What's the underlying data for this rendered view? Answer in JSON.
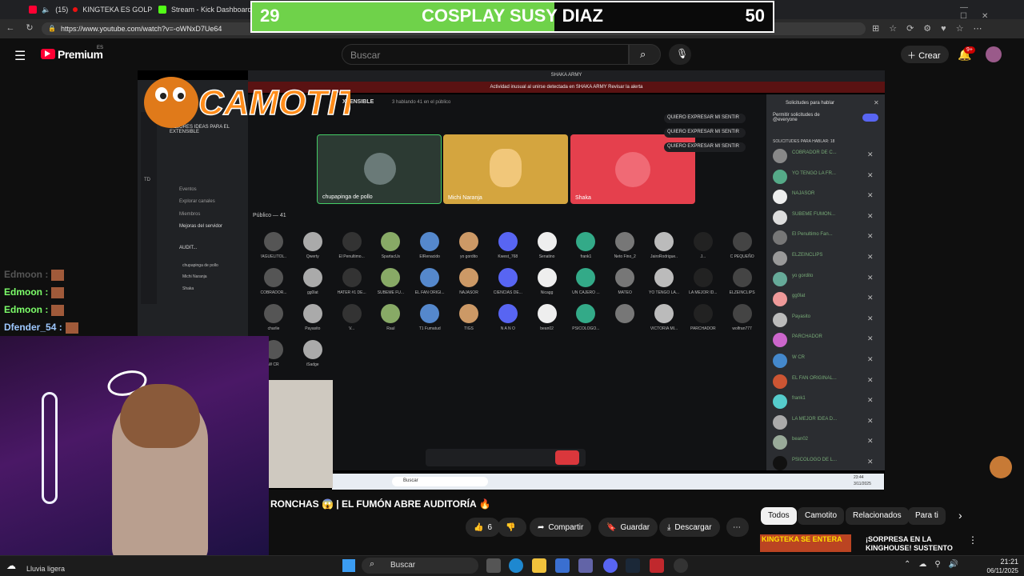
{
  "browser": {
    "tabs": [
      {
        "label": "(15)"
      },
      {
        "label": "KINGTEKA ES GOLP"
      },
      {
        "label": "Stream - Kick Dashboard"
      }
    ],
    "url": "https://www.youtube.com/watch?v=-oWNxD7Ue64"
  },
  "vote_overlay": {
    "left_count": "29",
    "title": "COSPLAY SUSY DIAZ",
    "right_count": "50",
    "left_fraction": 0.58
  },
  "youtube": {
    "logo_text": "Premium",
    "region": "ES",
    "search_placeholder": "Buscar",
    "create_label": "Crear",
    "notif_badge": "9+"
  },
  "video": {
    "logo_text": "CAMOTITO",
    "server_header": "SHAKA ARMY",
    "alert_text": "Actividad inusual al unirse detectada en SHAKA ARMY   Revisar la alerta",
    "channel_name": "XTENSIBLE",
    "channel_meta": "3 hablando   41 en el público",
    "sidebar": {
      "title": "MEJORES IDEAS PARA EL EXTENSIBLE",
      "items": [
        "Eventos",
        "Explorar canales",
        "Miembros",
        "Mejoras del servidor",
        "AUDIT...",
        "chupapinga de pollo",
        "Michi Naranja",
        "Shaka"
      ],
      "badge": "TD"
    },
    "speakers": [
      {
        "name": "chupapinga de pollo",
        "color": "#2c3a33"
      },
      {
        "name": "Michi Naranja",
        "color": "#d4a53f"
      },
      {
        "name": "Shaka",
        "color": "#e5404d"
      }
    ],
    "speaker_pill": "QUIERO EXPRESAR MI SENTIR",
    "public_label": "Público — 41",
    "audience": [
      "!AGUELITOL..",
      "Qwerty",
      "El Penultimo...",
      "SpartacUs",
      "ElRenacido",
      "yo gordito",
      "Kwest_768",
      "Senatino",
      "frank1",
      "Neto Fino_2",
      "JairoRodrigue..",
      "J...",
      "C PEQUEÑO",
      "COBRADOR...",
      "gg0lat",
      "HATER #1 DE...",
      "SUBEME FU...",
      "EL FAN ORIGI...",
      "NAJASOR",
      "CIENCIAS DE...",
      "Nicagg",
      "UN CAJERO ...",
      "MATEO",
      "YO TENGO LA...",
      "LA MEJOR ID...",
      "ELZEINCLIPS",
      "charlie",
      "Payasito",
      "V...",
      "Raul",
      "T1 Fumatud",
      "TIGS",
      "N A N O",
      "bean02",
      "PSICOLOGO...",
      "",
      "VICTORIA MI...",
      "PARCHADOR",
      "wolfran777",
      "W CR",
      "iSadge"
    ],
    "right_panel": {
      "title": "Solicitudes para hablar",
      "permit_label": "Permitir solicitudes de @everyone",
      "requests_label": "SOLICITUDES PARA HABLAR: 18",
      "requests": [
        "COBRADOR DE C...",
        "YO TENGO LA FR...",
        "NAJASOR",
        "SUBEME FUMON...",
        "El Penultimo Fan...",
        "ELZEINCLIPS",
        "yo gordito",
        "gg0lat",
        "Payasito",
        "PARCHADOR",
        "W CR",
        "EL FAN ORIGINAL...",
        "frank1",
        "LA MEJOR IDEA D...",
        "bean02",
        "PSICOLOGO DE L..."
      ]
    },
    "win_search": "Buscar",
    "win_time": "23:44",
    "win_date": "3/11/2025"
  },
  "chat": [
    {
      "user": "Edmoon :",
      "color": "#555555"
    },
    {
      "user": "Edmoon :",
      "color": "#7dff6a"
    },
    {
      "user": "Edmoon :",
      "color": "#7dff6a"
    },
    {
      "user": "Dfender_54 :",
      "color": "#9ec8ff"
    }
  ],
  "watch": {
    "title": "RONCHAS 😱 | EL FUMÓN ABRE AUDITORÍA 🔥",
    "likes": "6",
    "share": "Compartir",
    "save": "Guardar",
    "download": "Descargar",
    "chips": [
      "Todos",
      "Camotito",
      "Relacionados",
      "Para ti"
    ],
    "rec_thumb_text": "KINGTEKA SE ENTERA",
    "rec_title": "¡SORPRESA EN LA KINGHOUSE! SUSTENTO"
  },
  "os": {
    "weather": "Lluvia ligera",
    "search": "Buscar",
    "time": "21:21",
    "date": "06/11/2025"
  }
}
